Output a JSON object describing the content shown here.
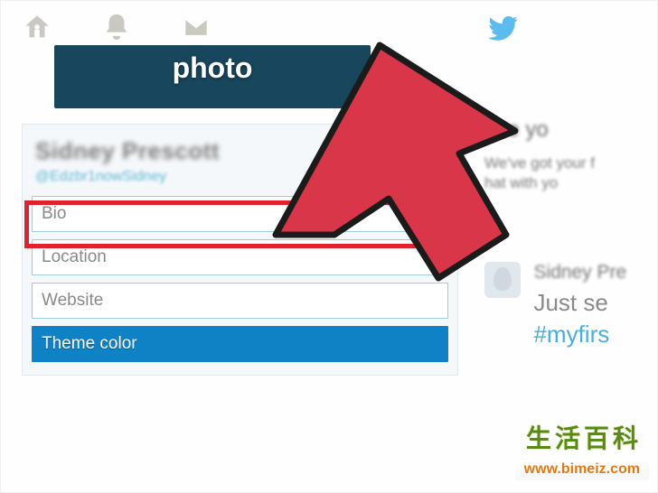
{
  "topbar": {
    "icons": [
      "home",
      "notifications",
      "messages",
      "twitter-bird"
    ]
  },
  "photo_card": {
    "label": "photo"
  },
  "profile": {
    "name": "Sidney Prescott",
    "handle": "@Edzbr1nowSidney",
    "fields": {
      "bio_placeholder": "Bio",
      "location_placeholder": "Location",
      "website_placeholder": "Website",
      "theme_label": "Theme color"
    }
  },
  "sidebar": {
    "heading": "ose yo",
    "line1": "We've got your f",
    "line2": "hat with yo"
  },
  "feed": {
    "name": "Sidney Pre",
    "text": "Just se",
    "hashtag": "#myfirs"
  },
  "watermark": {
    "cn": "生活百科",
    "url": "www.bimeiz.com"
  },
  "colors": {
    "highlight": "#e0222d",
    "arrow_fill": "#d9364a",
    "arrow_stroke": "#1b1b1b",
    "twitter_blue": "#5bbced",
    "theme_btn": "#0f82c6",
    "header_card": "#18465c"
  }
}
